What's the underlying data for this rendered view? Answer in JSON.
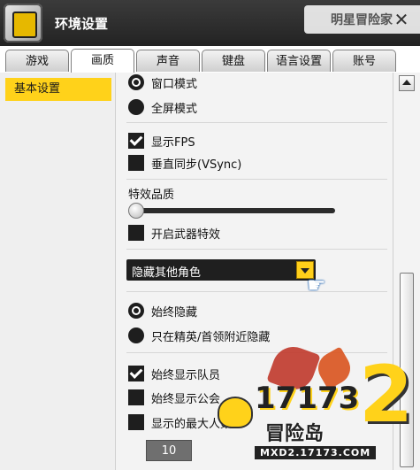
{
  "window": {
    "title": "环境设置",
    "background_title": "明星冒险家"
  },
  "tabs": [
    {
      "label": "游戏",
      "active": false
    },
    {
      "label": "画质",
      "active": true
    },
    {
      "label": "声音",
      "active": false
    },
    {
      "label": "键盘",
      "active": false
    },
    {
      "label": "语言设置",
      "active": false
    },
    {
      "label": "账号",
      "active": false
    }
  ],
  "sidebar": {
    "items": [
      {
        "label": "基本设置",
        "selected": true
      }
    ]
  },
  "display_mode": {
    "windowed_label": "窗口模式",
    "fullscreen_label": "全屏模式",
    "selected": "windowed"
  },
  "fps": {
    "label": "显示FPS",
    "checked": true
  },
  "vsync": {
    "label": "垂直同步(VSync)",
    "checked": false
  },
  "effect_quality": {
    "label": "特效品质",
    "value": 0.0
  },
  "weapon_effect": {
    "label": "开启武器特效",
    "checked": false
  },
  "other_characters": {
    "selected": "隐藏其他角色"
  },
  "hide_mode": {
    "always_hide_label": "始终隐藏",
    "elite_boss_label": "只在精英/首领附近隐藏",
    "selected": "always_hide"
  },
  "party": {
    "label": "始终显示队员",
    "checked": true
  },
  "guild": {
    "label": "始终显示公会",
    "checked": false
  },
  "max_display": {
    "label": "显示的最大人数",
    "checked": false,
    "value": "10"
  },
  "watermark": {
    "brand": "17173",
    "game": "冒险岛",
    "number": "2",
    "url": "MXD2.17173.COM"
  },
  "colors": {
    "accent": "#ffd21a",
    "titlebar": "#2c2c2c",
    "control": "#1e1e1e"
  }
}
